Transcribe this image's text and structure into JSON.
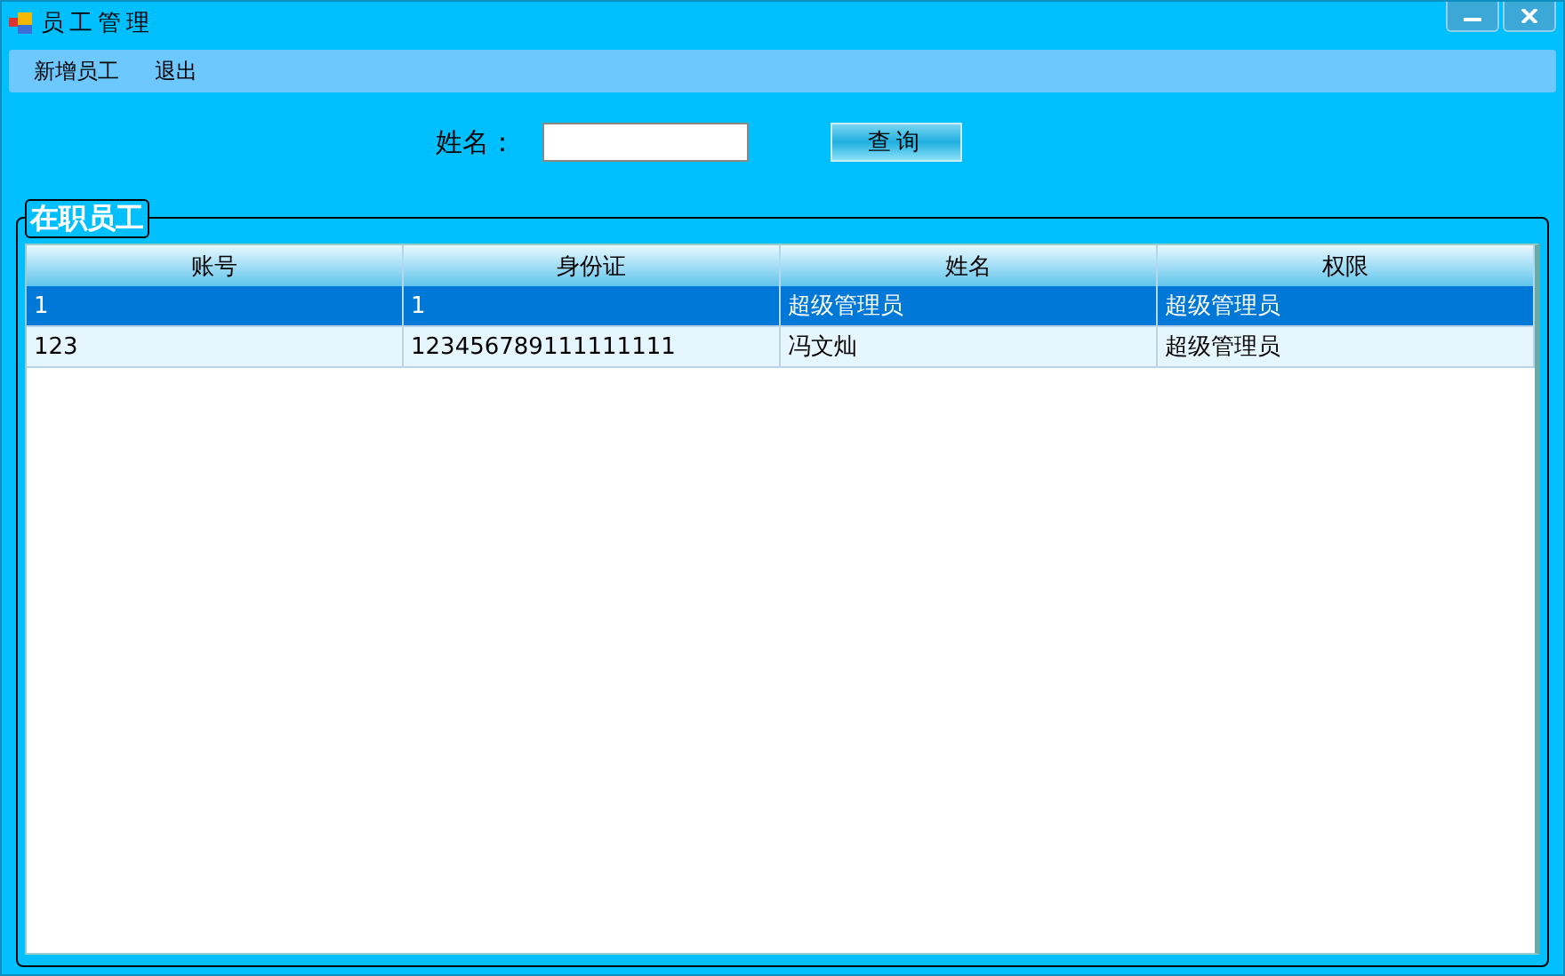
{
  "window": {
    "title": "员工管理"
  },
  "menu": [
    "新增员工",
    "退出"
  ],
  "search": {
    "label": "姓名：",
    "button": "查询"
  },
  "group": {
    "title": "在职员工"
  },
  "table": {
    "columns": [
      "账号",
      "身份证",
      "姓名",
      "权限"
    ],
    "rows": [
      {
        "cells": [
          "1",
          "1",
          "超级管理员",
          "超级管理员"
        ],
        "selected": true
      },
      {
        "cells": [
          "123",
          "123456789111111111",
          "冯文灿",
          "超级管理员"
        ],
        "selected": false
      }
    ]
  }
}
